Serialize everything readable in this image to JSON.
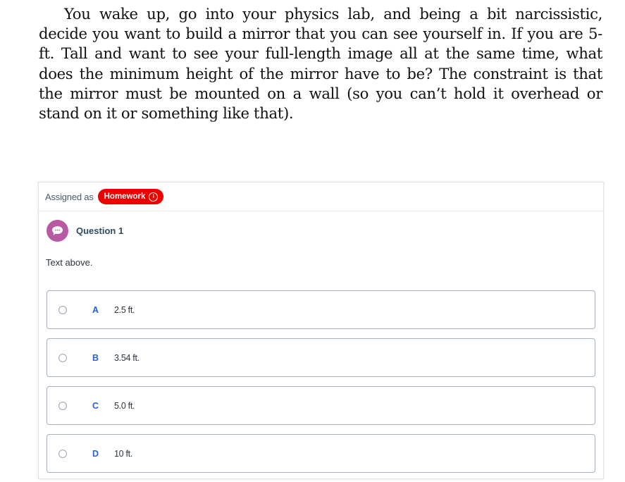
{
  "problem_text": "You wake up, go into your physics lab, and being a bit narcissistic, decide you want to build a mirror that you can see yourself in. If you are 5-ft. Tall and want to see your full-length image all at the same time, what does the minimum height of the mirror have to be? The constraint is that the mirror must be mounted on a wall (so you can’t hold it overhead or stand on it or something like that).",
  "card": {
    "assigned_label": "Assigned as",
    "badge_label": "Homework",
    "badge_icon": "info-icon",
    "badge_color": "#ee0000",
    "question_icon": "speech-bubble-icon",
    "question_title": "Question 1",
    "question_text": "Text above.",
    "options": [
      {
        "letter": "A",
        "text": "2.5 ft."
      },
      {
        "letter": "B",
        "text": "3.54 ft."
      },
      {
        "letter": "C",
        "text": "5.0 ft."
      },
      {
        "letter": "D",
        "text": "10 ft."
      }
    ]
  }
}
